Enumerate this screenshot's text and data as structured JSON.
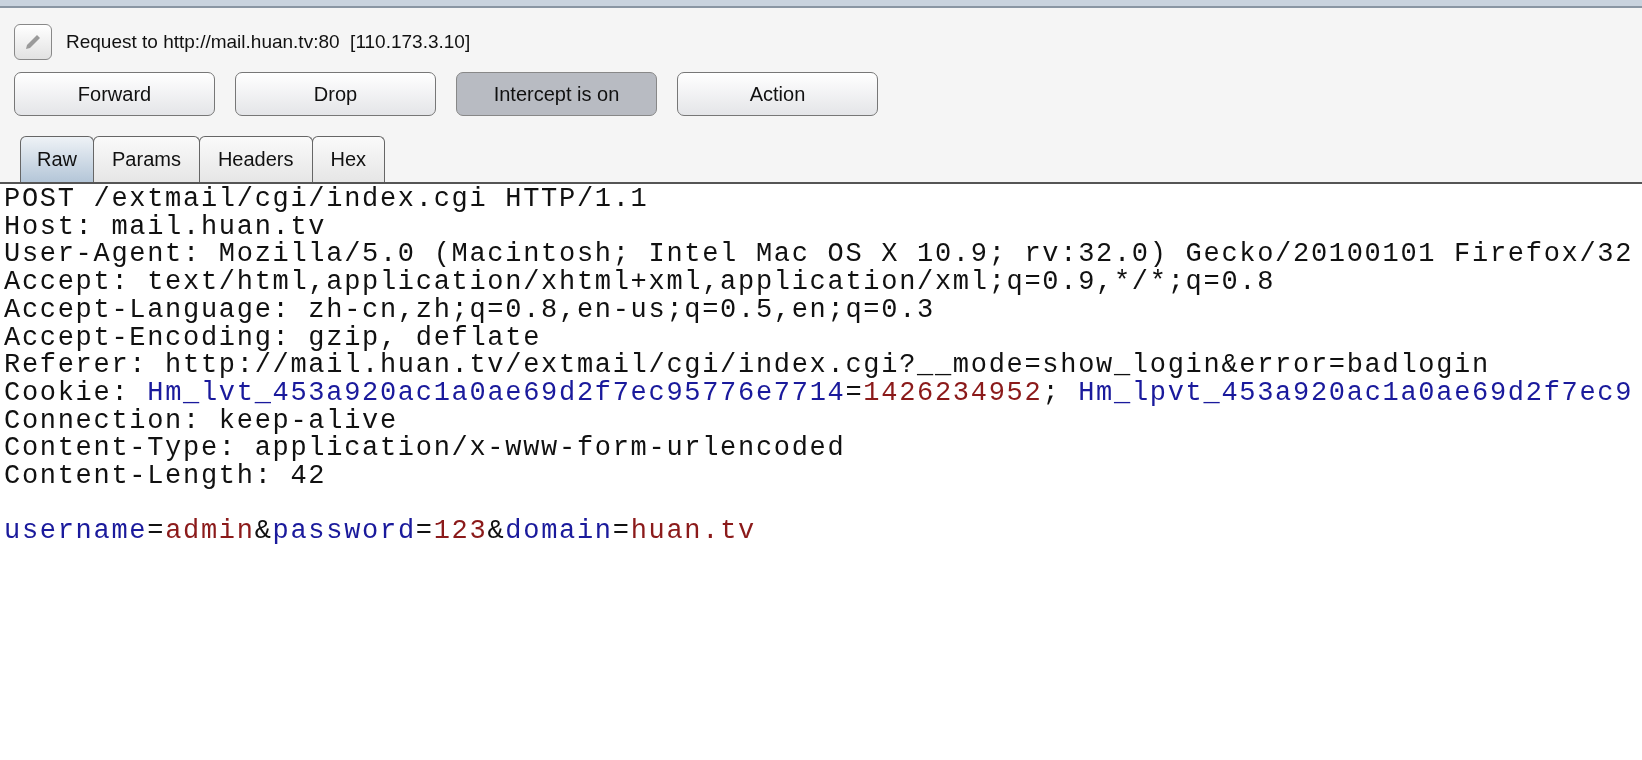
{
  "request": {
    "title": "Request to http://mail.huan.tv:80  [110.173.3.10]"
  },
  "buttons": [
    {
      "label": "Forward",
      "pressed": false
    },
    {
      "label": "Drop",
      "pressed": false
    },
    {
      "label": "Intercept is on",
      "pressed": true
    },
    {
      "label": "Action",
      "pressed": false
    }
  ],
  "tabs": [
    {
      "label": "Raw",
      "selected": true
    },
    {
      "label": "Params",
      "selected": false
    },
    {
      "label": "Headers",
      "selected": false
    },
    {
      "label": "Hex",
      "selected": false
    }
  ],
  "editor": {
    "lines": [
      {
        "kind": "text",
        "segments": [
          {
            "text": "POST /extmail/cgi/index.cgi HTTP/1.1",
            "kind": "plain"
          }
        ]
      },
      {
        "kind": "text",
        "segments": [
          {
            "text": "Host: mail.huan.tv",
            "kind": "plain"
          }
        ]
      },
      {
        "kind": "text",
        "segments": [
          {
            "text": "User-Agent: Mozilla/5.0 (Macintosh; Intel Mac OS X 10.9; rv:32.0) Gecko/20100101 Firefox/32",
            "kind": "plain"
          }
        ]
      },
      {
        "kind": "text",
        "segments": [
          {
            "text": "Accept: text/html,application/xhtml+xml,application/xml;q=0.9,*/*;q=0.8",
            "kind": "plain"
          }
        ]
      },
      {
        "kind": "text",
        "segments": [
          {
            "text": "Accept-Language: zh-cn,zh;q=0.8,en-us;q=0.5,en;q=0.3",
            "kind": "plain"
          }
        ]
      },
      {
        "kind": "text",
        "segments": [
          {
            "text": "Accept-Encoding: gzip, deflate",
            "kind": "plain"
          }
        ]
      },
      {
        "kind": "text",
        "segments": [
          {
            "text": "Referer: http://mail.huan.tv/extmail/cgi/index.cgi?__mode=show_login&error=badlogin",
            "kind": "plain"
          }
        ]
      },
      {
        "kind": "text",
        "segments": [
          {
            "text": "Cookie: ",
            "kind": "plain"
          },
          {
            "text": "Hm_lvt_453a920ac1a0ae69d2f7ec95776e7714",
            "kind": "name"
          },
          {
            "text": "=",
            "kind": "plain"
          },
          {
            "text": "1426234952",
            "kind": "value"
          },
          {
            "text": "; ",
            "kind": "plain"
          },
          {
            "text": "Hm_lpvt_453a920ac1a0ae69d2f7ec9",
            "kind": "name"
          }
        ]
      },
      {
        "kind": "text",
        "segments": [
          {
            "text": "Connection: keep-alive",
            "kind": "plain"
          }
        ]
      },
      {
        "kind": "text",
        "segments": [
          {
            "text": "Content-Type: application/x-www-form-urlencoded",
            "kind": "plain"
          }
        ]
      },
      {
        "kind": "text",
        "segments": [
          {
            "text": "Content-Length: 42",
            "kind": "plain"
          }
        ]
      },
      {
        "kind": "blank"
      },
      {
        "kind": "text",
        "segments": [
          {
            "text": "username",
            "kind": "name"
          },
          {
            "text": "=",
            "kind": "plain"
          },
          {
            "text": "admin",
            "kind": "value"
          },
          {
            "text": "&",
            "kind": "plain"
          },
          {
            "text": "password",
            "kind": "name"
          },
          {
            "text": "=",
            "kind": "plain"
          },
          {
            "text": "123",
            "kind": "value"
          },
          {
            "text": "&",
            "kind": "plain"
          },
          {
            "text": "domain",
            "kind": "name"
          },
          {
            "text": "=",
            "kind": "plain"
          },
          {
            "text": "huan.tv",
            "kind": "value"
          }
        ]
      }
    ]
  }
}
